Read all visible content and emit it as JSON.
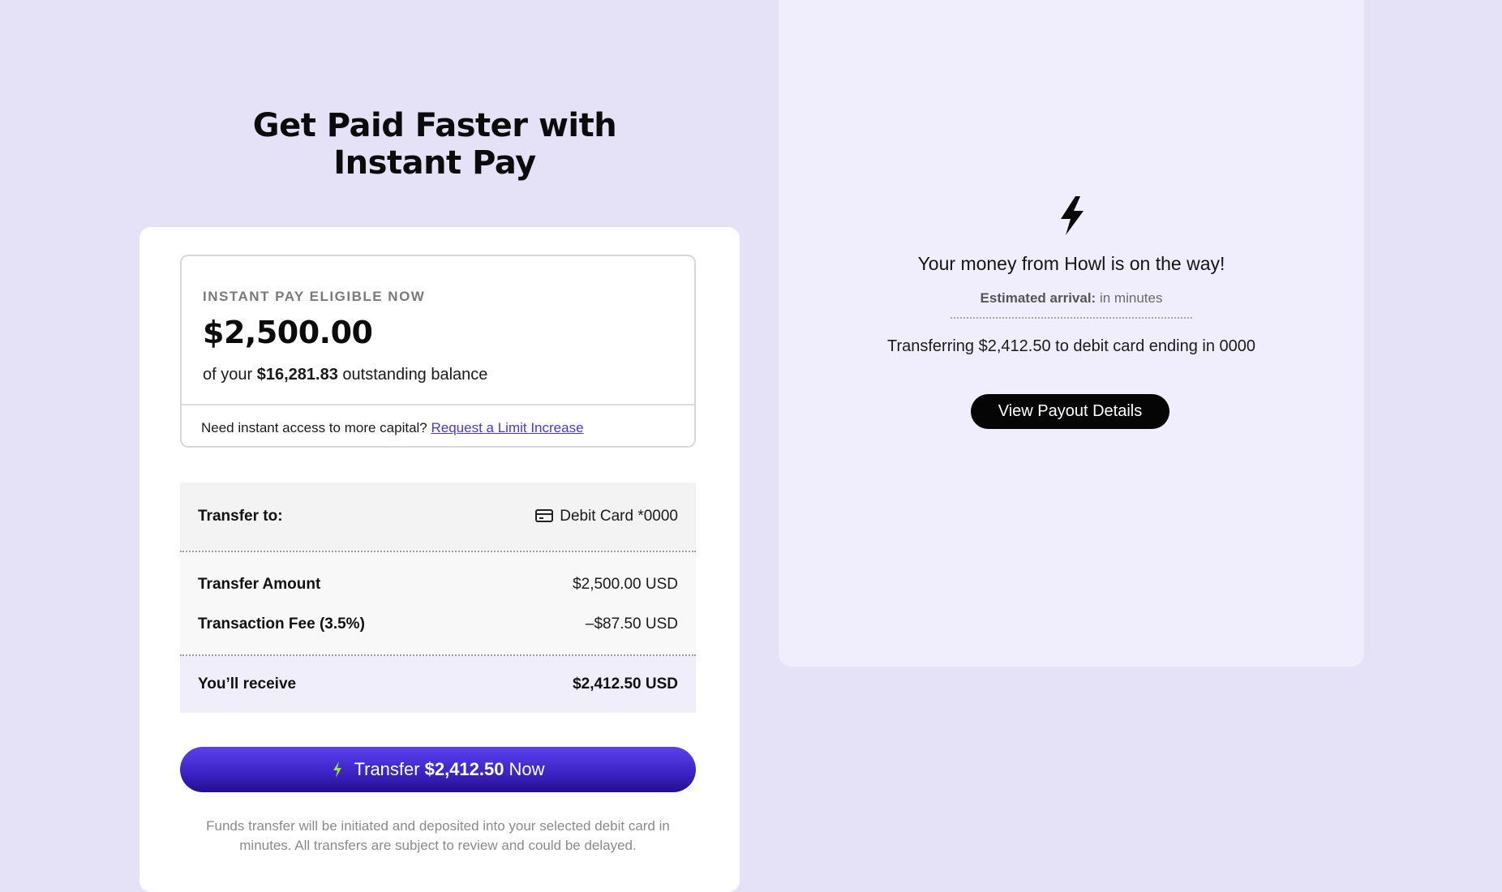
{
  "headline": {
    "line1": "Get Paid Faster with",
    "line2": "Instant Pay"
  },
  "eligible": {
    "label": "INSTANT PAY ELIGIBLE NOW",
    "amount": "$2,500.00",
    "balance_prefix": "of your",
    "balance_value": "$16,281.83",
    "balance_suffix": "outstanding balance",
    "footer_text": "Need instant access to more capital?",
    "limit_link": "Request a Limit Increase"
  },
  "summary": {
    "transfer_to_label": "Transfer to:",
    "transfer_to_value": "Debit Card *0000",
    "transfer_amount_label": "Transfer Amount",
    "transfer_amount_value": "$2,500.00 USD",
    "fee_label": "Transaction Fee (3.5%)",
    "fee_value": "–$87.50 USD",
    "receive_label": "You’ll receive",
    "receive_value": "$2,412.50 USD"
  },
  "transfer_button": {
    "prefix": "Transfer",
    "amount": "$2,412.50",
    "suffix": "Now"
  },
  "disclaimer": "Funds transfer will be initiated and deposited into your selected debit card in minutes. All transfers are subject to review and could be delayed.",
  "confirmation": {
    "title": "Your money from Howl is on the way!",
    "arrival_label": "Estimated arrival:",
    "arrival_value": "in minutes",
    "transferring": "Transferring $2,412.50 to debit card ending in 0000",
    "payout_button": "View Payout Details"
  },
  "icons": {
    "card": "credit-card-icon",
    "bolt": "lightning-bolt-icon"
  },
  "colors": {
    "page_background": "#e5e1f7",
    "accent": "#4a37d6",
    "button_gradient_top": "#5a41ee",
    "button_gradient_bottom": "#250e8c",
    "bolt_green": "#9ee33a",
    "confirmation_panel": "#f0eefc"
  }
}
